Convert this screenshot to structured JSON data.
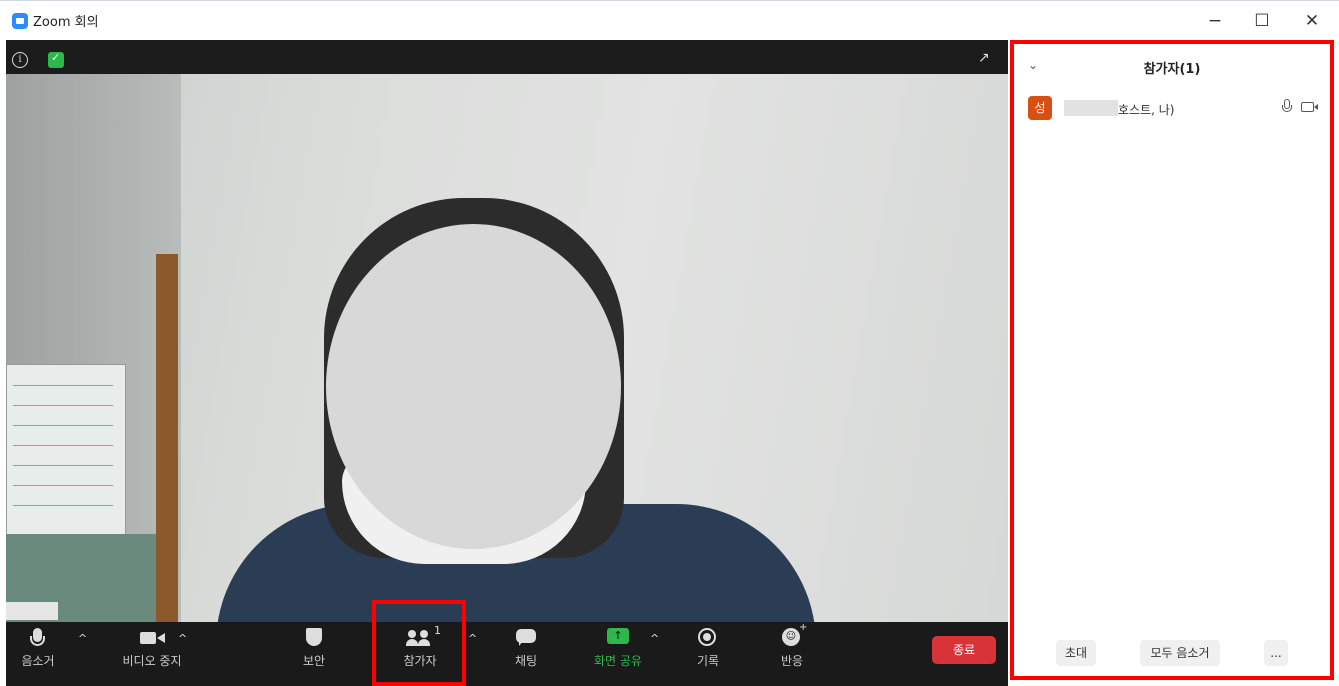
{
  "window": {
    "title": "Zoom 회의",
    "min": "−",
    "max": "☐",
    "close": "✕"
  },
  "video": {
    "info_icon": "i",
    "expand_icon": "↗"
  },
  "toolbar": {
    "mute": "음소거",
    "video_stop": "비디오 중지",
    "security": "보안",
    "participants": "참가자",
    "participants_count": "1",
    "chat": "채팅",
    "share": "화면 공유",
    "share_icon": "↑",
    "record": "기록",
    "reactions": "반응",
    "reactions_icon": "☺",
    "end": "종료",
    "caret": "^"
  },
  "panel": {
    "collapse_icon": "⌄",
    "title": "참가자(1)",
    "participants": [
      {
        "initial": "성",
        "role": "호스트, 나)"
      }
    ],
    "invite": "초대",
    "mute_all": "모두 음소거",
    "more": "..."
  },
  "colors": {
    "accent_red": "#ff0000",
    "end_button": "#d9333a",
    "share_green": "#2eb84b",
    "avatar_orange": "#d84f12"
  }
}
